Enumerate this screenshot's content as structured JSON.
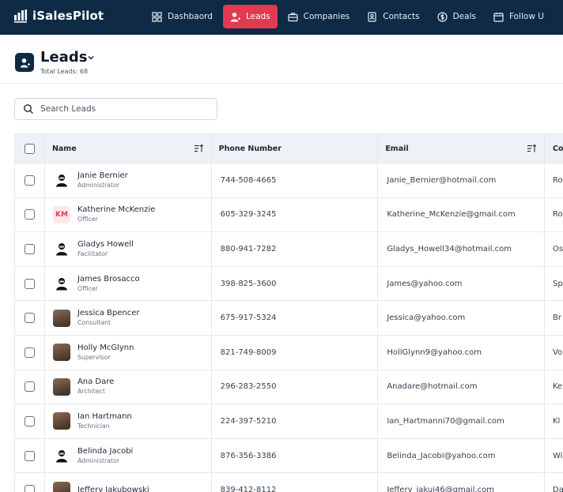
{
  "app": {
    "name": "iSalesPilot"
  },
  "nav": [
    {
      "label": "Dashbaord",
      "icon": "dashboard-grid-icon",
      "active": false
    },
    {
      "label": "Leads",
      "icon": "user-plus-icon",
      "active": true
    },
    {
      "label": "Companies",
      "icon": "briefcase-icon",
      "active": false
    },
    {
      "label": "Contacts",
      "icon": "contact-book-icon",
      "active": false
    },
    {
      "label": "Deals",
      "icon": "dollar-circle-icon",
      "active": false
    },
    {
      "label": "Follow U",
      "icon": "calendar-icon",
      "active": false
    }
  ],
  "header": {
    "title": "Leads",
    "total": "Total Leads: 68"
  },
  "search": {
    "placeholder": "Search Leads",
    "value": ""
  },
  "table": {
    "columns": [
      "Name",
      "Phone Number",
      "Email",
      "Co"
    ],
    "rows": [
      {
        "name": "Janie Bernier",
        "role": "Administrator",
        "phone": "744-508-4665",
        "email": "Janie_Bernier@hotmail.com",
        "company": "Ro",
        "avatar": "silhouette",
        "initials": ""
      },
      {
        "name": "Katherine McKenzie",
        "role": "Officer",
        "phone": "605-329-3245",
        "email": "Katherine_McKenzie@gmail.com",
        "company": "Ro",
        "avatar": "initials",
        "initials": "KM"
      },
      {
        "name": "Gladys Howell",
        "role": "Facilitator",
        "phone": "880-941-7282",
        "email": "Gladys_Howell34@hotmail.com",
        "company": "Os",
        "avatar": "silhouette",
        "initials": ""
      },
      {
        "name": "James Brosacco",
        "role": "Officer",
        "phone": "398-825-3600",
        "email": "James@yahoo.com",
        "company": "Sp",
        "avatar": "silhouette",
        "initials": ""
      },
      {
        "name": "Jessica Bpencer",
        "role": "Consultant",
        "phone": "675-917-5324",
        "email": "Jessica@yahoo.com",
        "company": "Br",
        "avatar": "photo",
        "initials": ""
      },
      {
        "name": "Holly McGlynn",
        "role": "Supervisor",
        "phone": "821-749-8009",
        "email": "HollGlynn9@yahoo.com",
        "company": "Vo",
        "avatar": "photo",
        "initials": ""
      },
      {
        "name": "Ana Dare",
        "role": "Architect",
        "phone": "296-283-2550",
        "email": "Anadare@hotmail.com",
        "company": "Ke",
        "avatar": "photo",
        "initials": ""
      },
      {
        "name": "Ian Hartmann",
        "role": "Technician",
        "phone": "224-397-5210",
        "email": "Ian_Hartmanni70@gmail.com",
        "company": "Kl",
        "avatar": "photo",
        "initials": ""
      },
      {
        "name": "Belinda Jacobi",
        "role": "Administrator",
        "phone": "876-356-3386",
        "email": "Belinda_Jacobi@yahoo.com",
        "company": "Wi",
        "avatar": "silhouette",
        "initials": ""
      },
      {
        "name": "Jeffery Jakubowski",
        "role": "",
        "phone": "839-412-8112",
        "email": "Jeffery_jakui46@gmail.com",
        "company": "Da",
        "avatar": "photo",
        "initials": ""
      }
    ]
  },
  "colors": {
    "nav_bg": "#0f2a44",
    "accent": "#e23a50",
    "header_row": "#eef1f5"
  }
}
